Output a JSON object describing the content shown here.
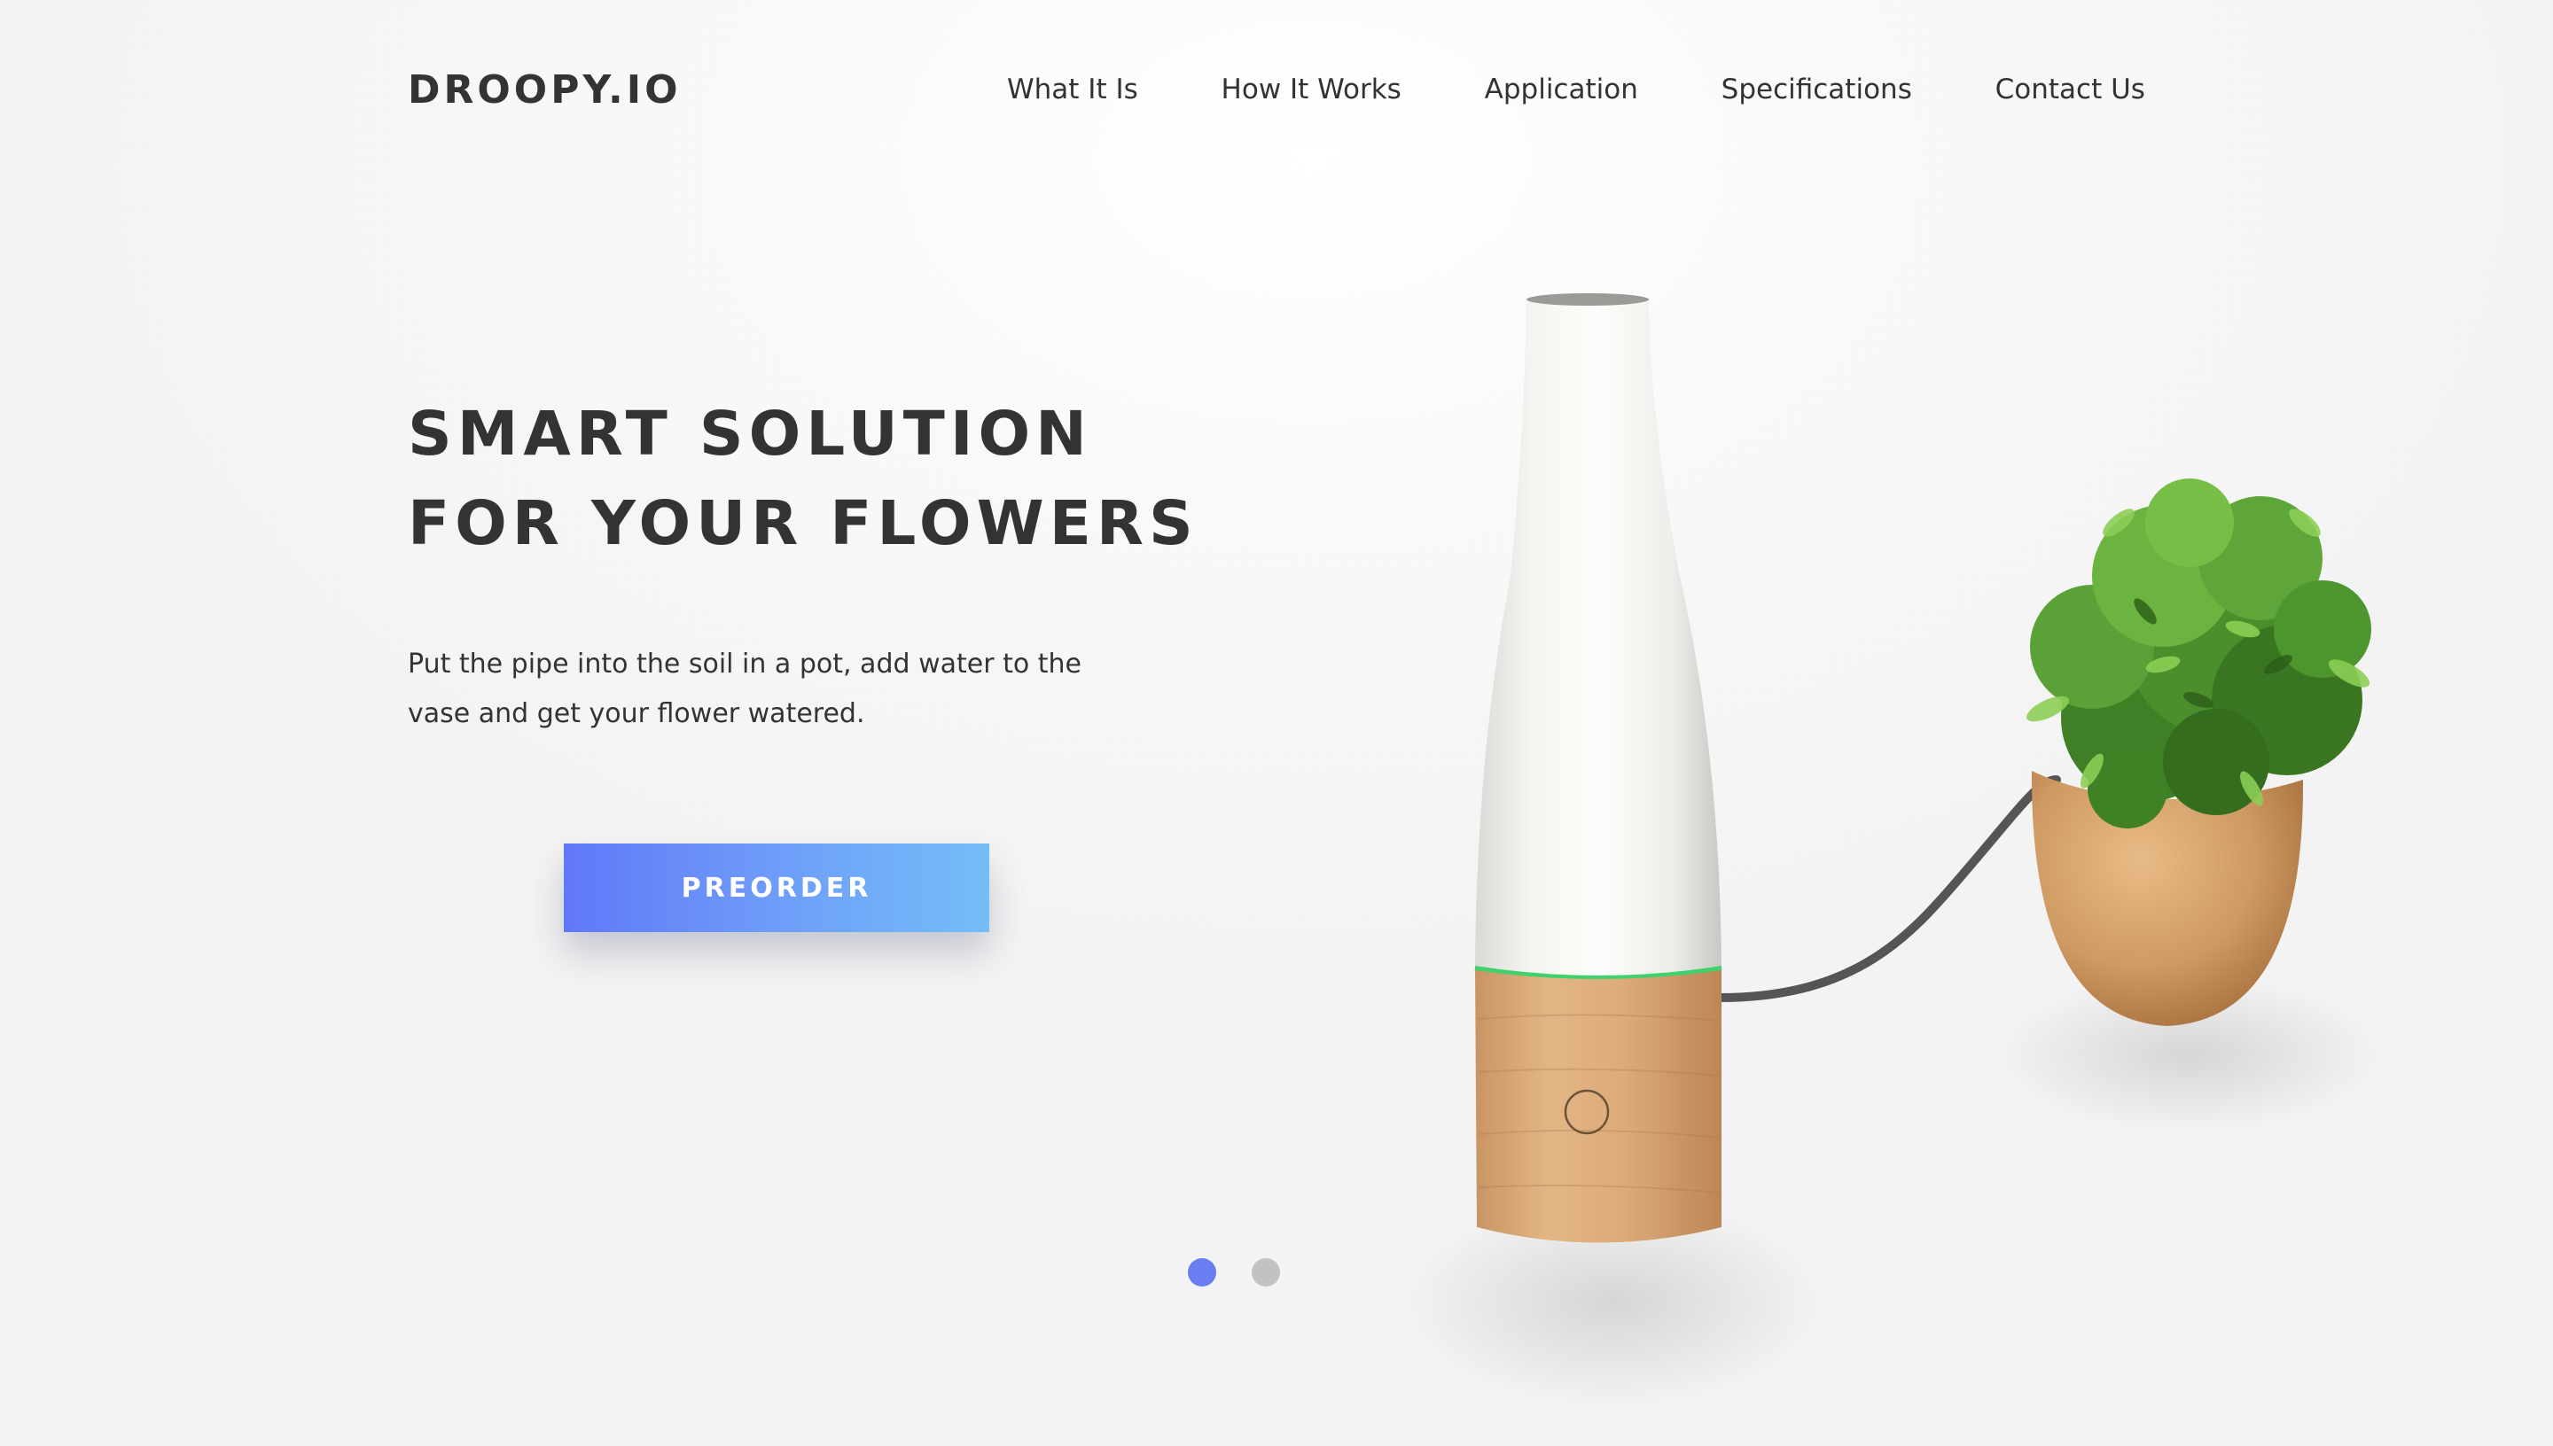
{
  "header": {
    "logo": "DROOPY.IO",
    "nav": [
      {
        "label": "What It Is"
      },
      {
        "label": "How It Works"
      },
      {
        "label": "Application"
      },
      {
        "label": "Specifications"
      },
      {
        "label": "Contact Us"
      }
    ]
  },
  "hero": {
    "title_line1": "SMART SOLUTION",
    "title_line2": "FOR YOUR FLOWERS",
    "desc_line1": "Put the pipe into the soil in a pot, add water to the",
    "desc_line2": "vase and get your flower watered.",
    "cta_label": "PREORDER"
  },
  "carousel": {
    "slides": 2,
    "active": 1
  },
  "colors": {
    "text": "#333333",
    "accent_start": "#6178f8",
    "accent_end": "#74bdf7",
    "dot_active": "#6a7ef2",
    "dot_inactive": "#c2c2c2",
    "led_green": "#3fd16b",
    "wood": "#d6a773",
    "vase": "#f1f1ee"
  },
  "illustration": {
    "icons": [
      "vase-device",
      "power-button-icon",
      "water-pipe",
      "potted-plant"
    ]
  }
}
